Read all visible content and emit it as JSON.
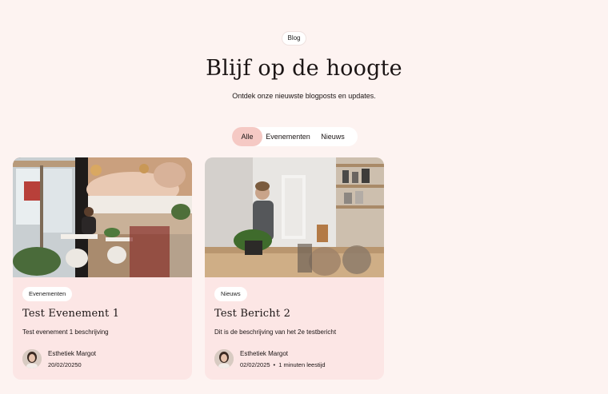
{
  "section_badge": "Blog",
  "title": "Blijf op de hoogte",
  "subtitle": "Ontdek onze nieuwste blogposts en updates.",
  "filters": [
    {
      "label": "Alle",
      "active": true
    },
    {
      "label": "Evenementen",
      "active": false
    },
    {
      "label": "Nieuws",
      "active": false
    }
  ],
  "posts": [
    {
      "category": "Evenementen",
      "title": "Test Evenement 1",
      "description": "Test evenement 1 beschrijving",
      "author": "Esthetiek Margot",
      "date": "20/02/20250",
      "reading_time": ""
    },
    {
      "category": "Nieuws",
      "title": "Test Bericht 2",
      "description": "Dit is de beschrijving van het 2e testbericht",
      "author": "Esthetiek Margot",
      "date": "02/02/2025",
      "separator": "•",
      "reading_time": "1 minuten leestijd"
    }
  ],
  "colors": {
    "background": "#fdf3f1",
    "card": "#fce6e5",
    "active_tab": "#f5c9c4"
  }
}
